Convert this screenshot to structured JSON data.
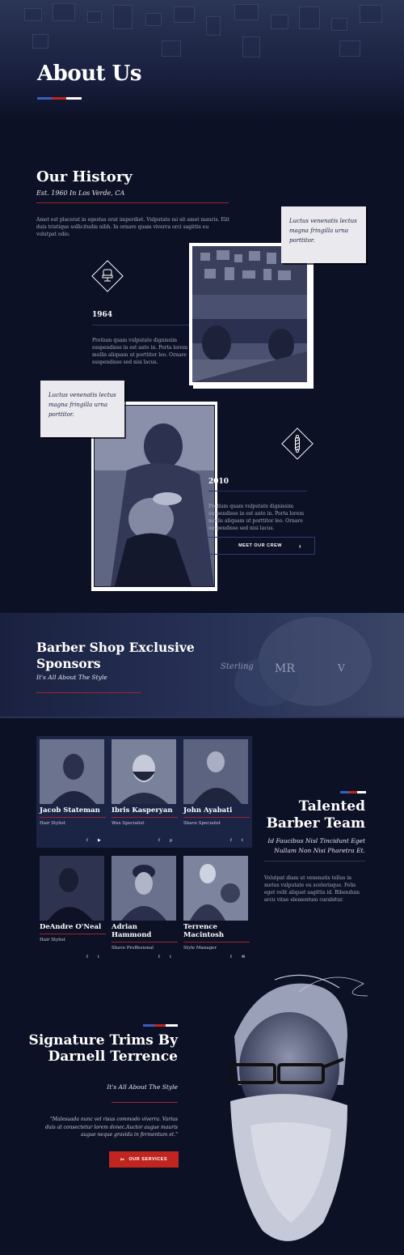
{
  "hero": {
    "title": "About Us"
  },
  "colors": {
    "blue": "#3a5fbf",
    "red": "#c0261f",
    "white": "#ffffff",
    "bg": "#0c1126"
  },
  "history": {
    "title": "Our History",
    "subtitle": "Est. 1960 In Los Verde, CA",
    "intro": "Amet est placerat in egestas erat imperdiet. Vulputate mi sit amet mauris. Elit duis tristique sollicitudin nibh. In ornare quam viverra orci sagittis eu volutpat odio.",
    "quote1": "Luctus venenatis lectus magna fringilla urna porttitor.",
    "quote2": "Luctus venenatis lectus magna fringilla urna porttitor.",
    "milestones": [
      {
        "year": "1964",
        "text": "Pretium quam vulputate dignissim suspendisse in est ante in. Porta lorem mollis aliquam ut porttitor leo. Ornare suspendisse sed nisi lacus.",
        "icon": "barber-chair-icon"
      },
      {
        "year": "2010",
        "text": "Pretium quam vulputate dignissim suspendisse in est ante in. Porta lorem mollis aliquam ut porttitor leo. Ornare suspendisse sed nisi lacus.",
        "icon": "barber-pole-icon"
      }
    ],
    "crew_button": "MEET OUR CREW",
    "crew_arrow": "›"
  },
  "sponsors": {
    "title": "Barber Shop Exclusive Sponsors",
    "subtitle": "It's All About The Style",
    "logos": [
      "Sterling",
      "MR",
      "V"
    ]
  },
  "team": {
    "title": "Talented Barber Team",
    "subtitle": "Id Faucibus Nisl Tincidunt Eget Nullam Non Nisi Pharetra Et.",
    "description": "Volutpat diam ut venenatis tellus in metus vulputate eu scelerisque. Felis eget velit aliquet sagittis id. Bibendum arcu vitae elementum curabitur.",
    "members": [
      {
        "name": "Jacob Stateman",
        "role": "Hair Stylist",
        "social": [
          "f",
          "▶"
        ]
      },
      {
        "name": "Ibris Kasperyan",
        "role": "Wax Specialist",
        "social": [
          "f",
          "p"
        ]
      },
      {
        "name": "John Ayabati",
        "role": "Shave Specialist",
        "social": [
          "f",
          "t"
        ]
      },
      {
        "name": "DeAndre O'Neal",
        "role": "Hair Stylist",
        "social": [
          "f",
          "t"
        ]
      },
      {
        "name": "Adrian Hammond",
        "role": "Shave Proffesional",
        "social": [
          "f",
          "t"
        ]
      },
      {
        "name": "Terrence Macintosh",
        "role": "Style Manager",
        "social": [
          "f",
          "✉"
        ]
      }
    ]
  },
  "signature": {
    "title": "Signature Trims By Darnell Terrence",
    "subtitle": "It's All About The Style",
    "quote": "\"Malesuada nunc vel risus commodo viverra. Varius duis at consectetur lorem donec.Auctor augue mauris augue neque gravida in fermentum et.\"",
    "button": "OUR SERVICES"
  }
}
